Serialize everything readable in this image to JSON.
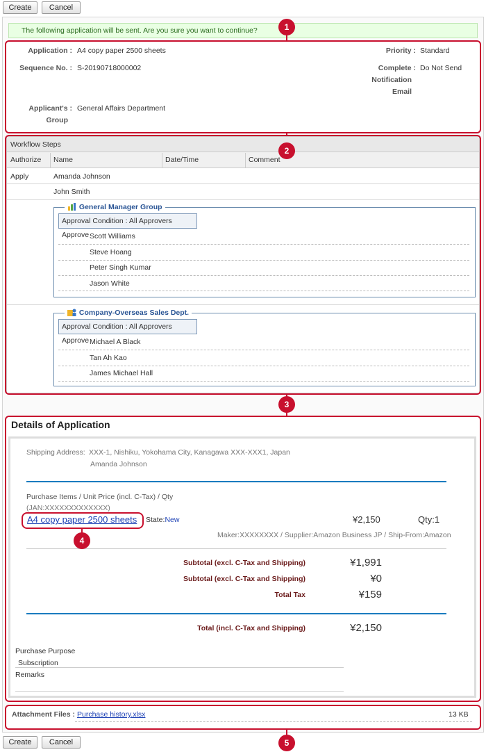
{
  "toolbar": {
    "create_label": "Create",
    "cancel_label": "Cancel"
  },
  "confirm_message": "The following application will be sent. Are you sure you want to continue?",
  "markers": [
    "1",
    "2",
    "3",
    "4",
    "5"
  ],
  "summary": {
    "application_label": "Application :",
    "application_value": "A4 copy paper 2500 sheets",
    "sequence_label": "Sequence No. :",
    "sequence_value": "S-20190718000002",
    "group_label_1": "Applicant's :",
    "group_label_2": "Group",
    "group_value": "General Affairs Department",
    "priority_label": "Priority :",
    "priority_value": "Standard",
    "complete_label_1": "Complete :",
    "complete_label_2": "Notification",
    "complete_label_3": "Email",
    "complete_value": "Do Not Send"
  },
  "workflow": {
    "title": "Workflow Steps",
    "columns": [
      "Authorize",
      "Name",
      "Date/Time",
      "Comment"
    ],
    "rows": [
      {
        "authorize": "Apply",
        "name": "Amanda Johnson"
      },
      {
        "authorize": "",
        "name": "John Smith"
      }
    ],
    "groups": [
      {
        "title": "General Manager Group",
        "condition_label": "Approval Condition",
        "condition_value": "All Approvers Approve",
        "approvers": [
          "Scott Williams",
          "Steve Hoang",
          "Peter Singh Kumar",
          "Jason White"
        ]
      },
      {
        "title": "Company-Overseas Sales Dept.",
        "condition_label": "Approval Condition",
        "condition_value": "All Approvers Approve",
        "approvers": [
          "Michael A Black",
          "Tan Ah Kao",
          "James Michael Hall"
        ]
      }
    ]
  },
  "details": {
    "title": "Details of Application",
    "shipping_label": "Shipping Address:",
    "shipping_line1": "XXX-1, Nishiku, Yokohama City, Kanagawa XXX-XXX1, Japan",
    "shipping_line2": "Amanda Johnson",
    "items_header": "Purchase Items / Unit Price (incl. C-Tax) / Qty",
    "jan": "(JAN:XXXXXXXXXXXXX)",
    "item_link": "A4 copy paper 2500 sheets",
    "state_label": "State:",
    "state_value": "New",
    "unit_price": "¥2,150",
    "qty": "Qty:1",
    "maker_line": "Maker:XXXXXXXX / Supplier:Amazon Business JP / Ship-From:Amazon",
    "subtotal_label": "Subtotal (excl. C-Tax and Shipping)",
    "subtotal_value": "¥1,991",
    "subtotal2_label": "Subtotal (excl. C-Tax and Shipping)",
    "subtotal2_value": "¥0",
    "tax_label": "Total Tax",
    "tax_value": "¥159",
    "total_label": "Total (incl. C-Tax and Shipping)",
    "total_value": "¥2,150",
    "purpose_label": "Purchase Purpose",
    "purpose_value": "Subscription",
    "remarks_label": "Remarks"
  },
  "attachment": {
    "label": "Attachment Files :",
    "file_name": "Purchase history.xlsx",
    "file_size": "13 KB"
  },
  "colors": {
    "accent_red": "#c8102e",
    "link_blue": "#1a3fb4",
    "success_bg": "#e9ffe3",
    "rule_blue": "#1a7bbf"
  },
  "icons": [
    "group-icon",
    "department-icon"
  ]
}
